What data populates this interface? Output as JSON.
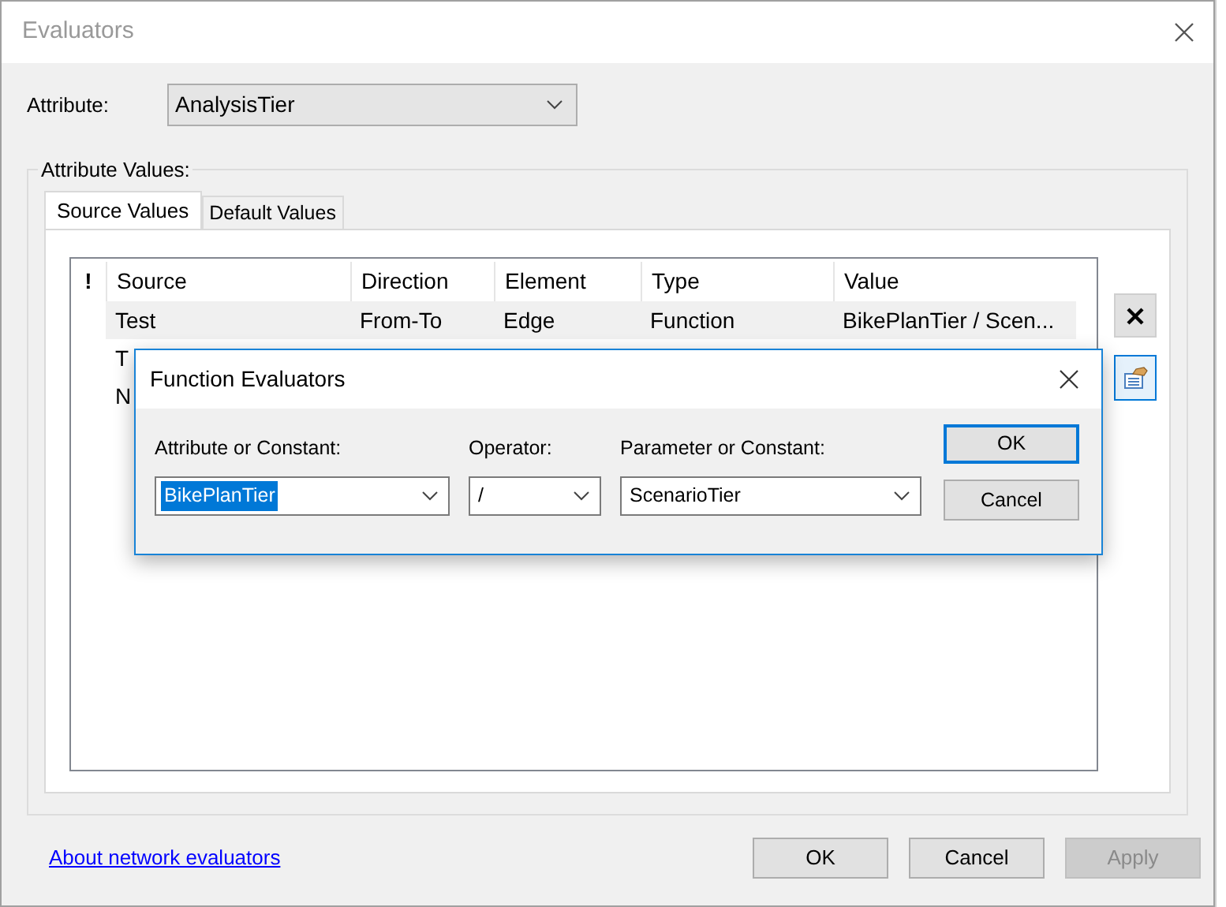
{
  "window": {
    "title": "Evaluators"
  },
  "attribute": {
    "label": "Attribute:",
    "value": "AnalysisTier"
  },
  "group": {
    "title": "Attribute Values:"
  },
  "tabs": [
    {
      "label": "Source Values",
      "selected": true
    },
    {
      "label": "Default Values",
      "selected": false
    }
  ],
  "table": {
    "flag_header": "!",
    "columns": [
      "Source",
      "Direction",
      "Element",
      "Type",
      "Value"
    ],
    "rows": [
      {
        "selected": true,
        "cells": [
          "Test",
          "From-To",
          "Edge",
          "Function",
          "BikePlanTier / Scen..."
        ]
      },
      {
        "selected": false,
        "cells": [
          "T"
        ]
      },
      {
        "selected": false,
        "cells": [
          "N"
        ]
      }
    ]
  },
  "link": "About network evaluators",
  "buttons": [
    {
      "label": "OK",
      "disabled": false
    },
    {
      "label": "Cancel",
      "disabled": false
    },
    {
      "label": "Apply",
      "disabled": true
    }
  ],
  "dialog": {
    "title": "Function Evaluators",
    "fields": [
      {
        "label": "Attribute or Constant:",
        "value": "BikePlanTier",
        "highlighted": true
      },
      {
        "label": "Operator:",
        "value": "/",
        "highlighted": false
      },
      {
        "label": "Parameter or Constant:",
        "value": "ScenarioTier",
        "highlighted": false
      }
    ],
    "buttons": [
      {
        "label": "OK",
        "default": true
      },
      {
        "label": "Cancel",
        "default": false
      }
    ]
  }
}
